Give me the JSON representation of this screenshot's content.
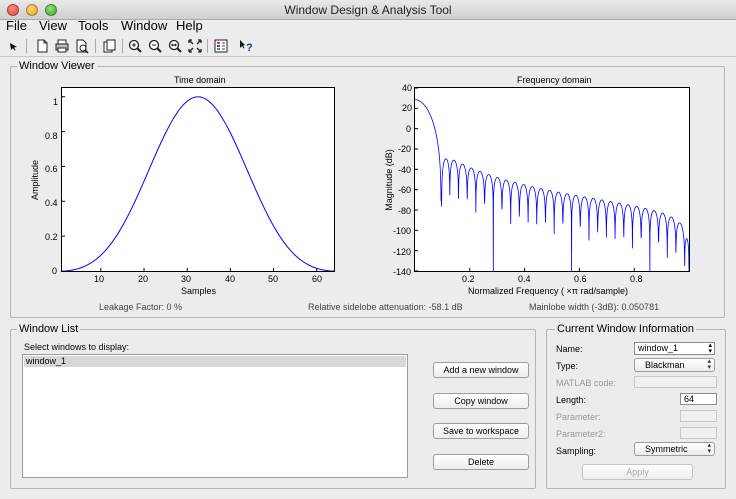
{
  "window": {
    "title": "Window Design & Analysis Tool"
  },
  "menu": {
    "items": [
      "File",
      "View",
      "Tools",
      "Window",
      "Help"
    ]
  },
  "toolbar": {
    "icons": [
      "arrow-icon",
      "new-icon",
      "print-icon",
      "print-preview-icon",
      "open-icon",
      "zoom-in-icon",
      "zoom-out-icon",
      "zoom-x-icon",
      "full-view-icon",
      "legend-icon",
      "whats-this-icon"
    ]
  },
  "viewer": {
    "label": "Window Viewer",
    "time": {
      "title": "Time domain",
      "xlabel": "Samples",
      "ylabel": "Amplitude",
      "xticks": [
        "10",
        "20",
        "30",
        "40",
        "50",
        "60"
      ],
      "yticks": [
        "0",
        "0.2",
        "0.4",
        "0.6",
        "0.8",
        "1"
      ]
    },
    "freq": {
      "title": "Frequency domain",
      "xlabel": "Normalized Frequency (  ×π rad/sample)",
      "ylabel": "Magnitude (dB)",
      "xticks": [
        "0.2",
        "0.4",
        "0.6",
        "0.8"
      ],
      "yticks": [
        "40",
        "20",
        "0",
        "-20",
        "-40",
        "-60",
        "-80",
        "-100",
        "-120",
        "-140"
      ]
    },
    "stats": {
      "leakage": "Leakage Factor: 0 %",
      "sidelobe": "Relative sidelobe attenuation: -58.1 dB",
      "mainlobe": "Mainlobe width (-3dB): 0.050781"
    }
  },
  "windowList": {
    "label": "Window List",
    "prompt": "Select windows to display:",
    "items": [
      "window_1"
    ],
    "buttons": {
      "add": "Add a new window",
      "copy": "Copy window",
      "save": "Save to workspace",
      "delete": "Delete"
    }
  },
  "info": {
    "label": "Current Window Information",
    "name_label": "Name:",
    "name_value": "window_1",
    "type_label": "Type:",
    "type_value": "Blackman",
    "matlab_label": "MATLAB code:",
    "length_label": "Length:",
    "length_value": "64",
    "param_label": "Parameter:",
    "param2_label": "Parameter2:",
    "sampling_label": "Sampling:",
    "sampling_value": "Symmetric",
    "apply": "Apply"
  },
  "chart_data": [
    {
      "type": "line",
      "title": "Time domain",
      "xlabel": "Samples",
      "ylabel": "Amplitude",
      "xlim": [
        1,
        64
      ],
      "ylim": [
        0,
        1.05
      ],
      "series": [
        {
          "function": "blackman",
          "length": 64,
          "peak": 1,
          "peak_at": 32.5
        }
      ],
      "color": "#0000ff"
    },
    {
      "type": "line",
      "title": "Frequency domain",
      "xlabel": "Normalized Frequency (  ×π rad/sample)",
      "ylabel": "Magnitude (dB)",
      "xlim": [
        0,
        1
      ],
      "ylim": [
        -140,
        40
      ],
      "series": [
        {
          "peak_db": 30.2,
          "first_null": 0.09,
          "first_sidelobe_db": -30,
          "sidelobe_at_nyquist_db": -122,
          "nulls_to": [
            -72,
            -135
          ]
        }
      ],
      "color": "#0000ff"
    }
  ]
}
